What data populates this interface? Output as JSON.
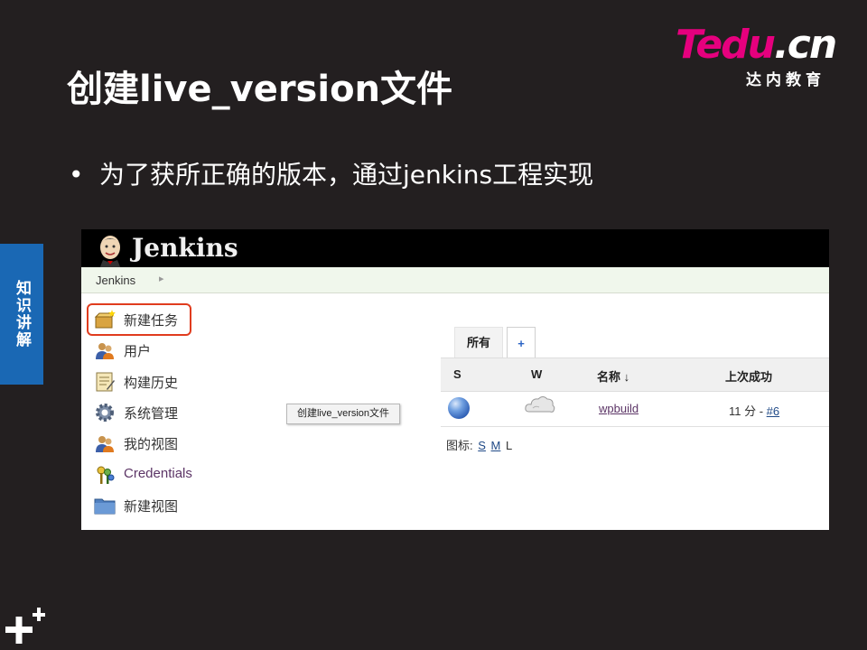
{
  "slide": {
    "title": "创建live_version文件",
    "bullet": "为了获所正确的版本，通过jenkins工程实现",
    "side_tab": "知识讲解"
  },
  "logo": {
    "brand_pink": "Tedu",
    "brand_white": ".cn",
    "subtitle": "达内教育",
    "accent_color": "#e6007e"
  },
  "jenkins": {
    "brand": "Jenkins",
    "breadcrumb": "Jenkins",
    "tasks": [
      {
        "label": "新建任务",
        "icon": "new-item-icon"
      },
      {
        "label": "用户",
        "icon": "users-icon"
      },
      {
        "label": "构建历史",
        "icon": "build-history-icon"
      },
      {
        "label": "系统管理",
        "icon": "gear-icon"
      },
      {
        "label": "我的视图",
        "icon": "my-views-icon"
      },
      {
        "label": "Credentials",
        "icon": "credentials-icon"
      },
      {
        "label": "新建视图",
        "icon": "folder-icon"
      }
    ],
    "tooltip": "创建live_version文件",
    "view_tab": "所有",
    "add_tab": "+",
    "table": {
      "headers": [
        "S",
        "W",
        "名称 ↓",
        "上次成功"
      ],
      "rows": [
        {
          "status": "blue",
          "weather": "cloudy",
          "name": "wpbuild",
          "last_success_time": "11 分 - ",
          "last_success_build": "#6"
        }
      ]
    },
    "legend": {
      "label": "图标:",
      "sizes": [
        "S",
        "M",
        "L"
      ]
    },
    "highlight_color": "#e03c1e"
  }
}
